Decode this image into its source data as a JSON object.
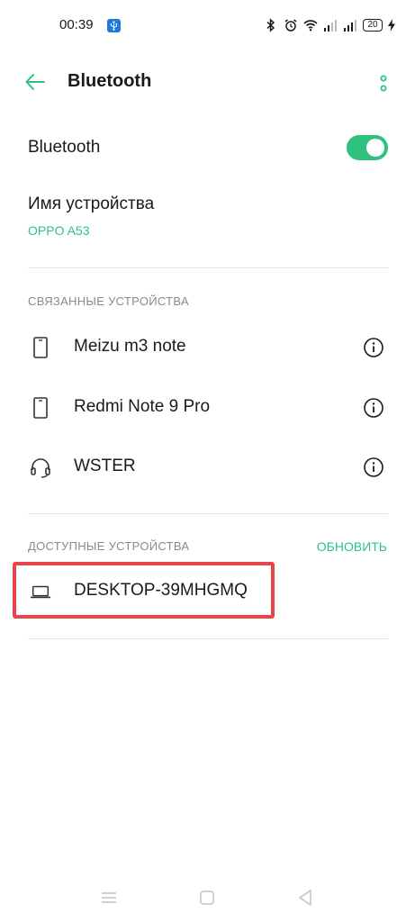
{
  "status_bar": {
    "time": "00:39",
    "battery_level": "20",
    "icons": [
      "usb-icon",
      "bluetooth-icon",
      "alarm-icon",
      "wifi-icon",
      "signal-icon",
      "signal-icon",
      "battery-icon",
      "charging-icon"
    ]
  },
  "app_bar": {
    "title": "Bluetooth"
  },
  "bluetooth_toggle": {
    "label": "Bluetooth",
    "on": true
  },
  "device_name": {
    "title": "Имя устройства",
    "value": "OPPO A53"
  },
  "paired_section": {
    "header": "СВЯЗАННЫЕ УСТРОЙСТВА",
    "devices": [
      {
        "name": "Meizu m3 note",
        "icon": "phone-icon"
      },
      {
        "name": "Redmi Note 9 Pro",
        "icon": "phone-icon"
      },
      {
        "name": "WSTER",
        "icon": "headset-icon"
      }
    ]
  },
  "available_section": {
    "header": "ДОСТУПНЫЕ УСТРОЙСТВА",
    "refresh_label": "ОБНОВИТЬ",
    "devices": [
      {
        "name": "DESKTOP-39MHGMQ",
        "icon": "laptop-icon"
      }
    ]
  },
  "colors": {
    "accent": "#2ec27e",
    "highlight": "#e8444a"
  }
}
